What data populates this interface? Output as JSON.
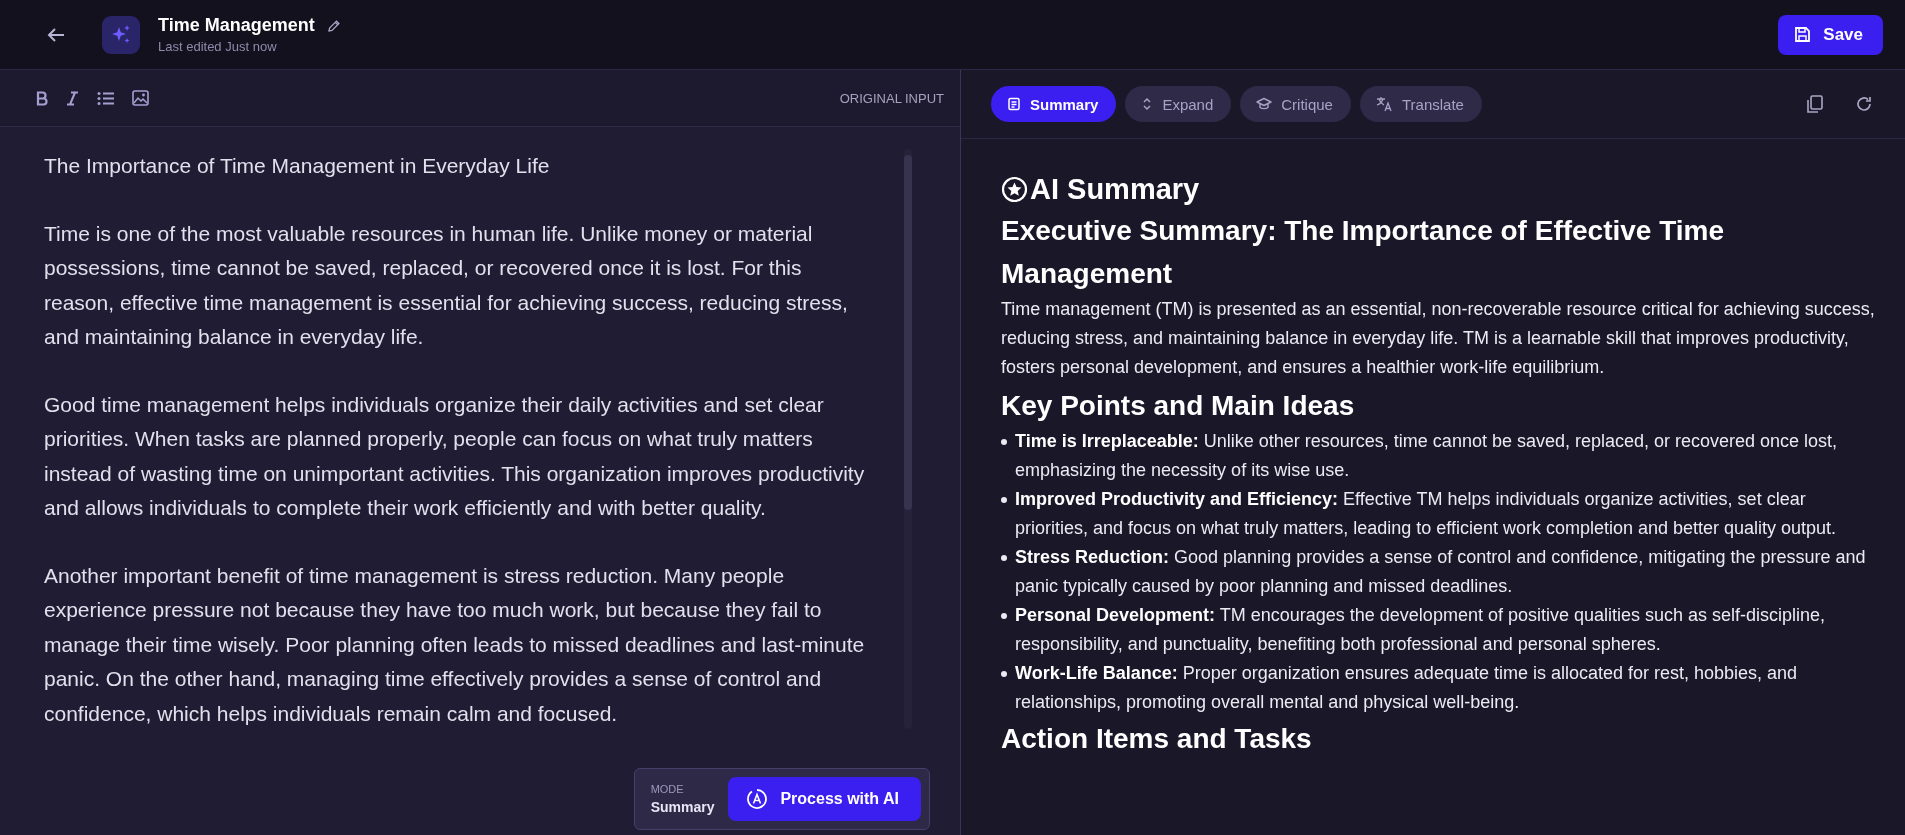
{
  "header": {
    "title": "Time Management",
    "subtitle": "Last edited Just now",
    "save": "Save"
  },
  "editor": {
    "label": "ORIGINAL INPUT",
    "paragraphs": [
      "The Importance of Time Management in Everyday Life",
      "Time is one of the most valuable resources in human life. Unlike money or material possessions, time cannot be saved, replaced, or recovered once it is lost. For this reason, effective time management is essential for achieving success, reducing stress, and maintaining balance in everyday life.",
      "Good time management helps individuals organize their daily activities and set clear priorities. When tasks are planned properly, people can focus on what truly matters instead of wasting time on unimportant activities. This organization improves productivity and allows individuals to complete their work efficiently and with better quality.",
      "Another important benefit of time management is stress reduction. Many people experience pressure not because they have too much work, but because they fail to manage their time wisely. Poor planning often leads to missed deadlines and last-minute panic. On the other hand, managing time effectively provides a sense of control and confidence, which helps individuals remain calm and focused."
    ]
  },
  "process": {
    "mode_label": "MODE",
    "mode": "Summary",
    "button": "Process with AI"
  },
  "tabs": [
    {
      "label": "Summary",
      "kind": "doc",
      "selected": true
    },
    {
      "label": "Expand",
      "kind": "expand",
      "selected": false
    },
    {
      "label": "Critique",
      "kind": "cap",
      "selected": false
    },
    {
      "label": "Translate",
      "kind": "translate",
      "selected": false
    }
  ],
  "output": {
    "title": "AI Summary",
    "heading": "Executive Summary: The Importance of Effective Time Management",
    "intro": "Time management (TM) is presented as an essential, non-recoverable resource critical for achieving success, reducing stress, and maintaining balance in everyday life. TM is a learnable skill that improves productivity, fosters personal development, and ensures a healthier work-life equilibrium.",
    "points_heading": "Key Points and Main Ideas",
    "points": [
      {
        "term": "Time is Irreplaceable:",
        "text": "Unlike other resources, time cannot be saved, replaced, or recovered once lost, emphasizing the necessity of its wise use."
      },
      {
        "term": "Improved Productivity and Efficiency:",
        "text": "Effective TM helps individuals organize activities, set clear priorities, and focus on what truly matters, leading to efficient work completion and better quality output."
      },
      {
        "term": "Stress Reduction:",
        "text": "Good planning provides a sense of control and confidence, mitigating the pressure and panic typically caused by poor planning and missed deadlines."
      },
      {
        "term": "Personal Development:",
        "text": "TM encourages the development of positive qualities such as self-discipline, responsibility, and punctuality, benefiting both professional and personal spheres."
      },
      {
        "term": "Work-Life Balance:",
        "text": "Proper organization ensures adequate time is allocated for rest, hobbies, and relationships, promoting overall mental and physical well-being."
      }
    ],
    "actions_heading": "Action Items and Tasks"
  }
}
